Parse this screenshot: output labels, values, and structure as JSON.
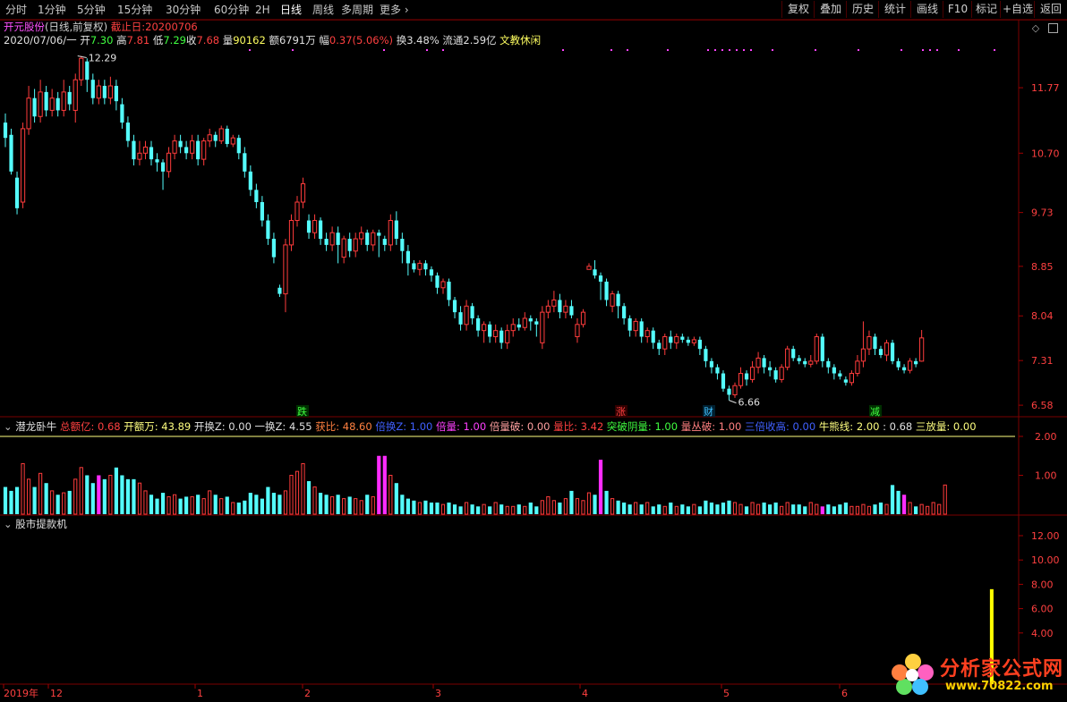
{
  "toolbar": {
    "periods": [
      "分时",
      "1分钟",
      "5分钟",
      "15分钟",
      "30分钟",
      "60分钟",
      "2H",
      "日线",
      "周线",
      "多周期",
      "更多"
    ],
    "active_index": 7,
    "right_buttons": [
      "复权",
      "叠加",
      "历史",
      "统计",
      "画线",
      "F10",
      "标记",
      "+自选",
      "返回"
    ]
  },
  "header": {
    "stock_name": "开元股份",
    "mode": "(日线,前复权)",
    "cutoff_label": "截止日:",
    "cutoff_date": "20200706",
    "date": "2020/07/06/一",
    "open_label": "开",
    "open": "7.30",
    "high_label": "高",
    "high": "7.81",
    "low_label": "低",
    "low": "7.29",
    "close_label": "收",
    "close": "7.68",
    "volume_label": "量",
    "volume": "90162",
    "amount_label": "额",
    "amount": "6791万",
    "change_label": "幅",
    "change": "0.37(5.06%)",
    "turnover_label": "换",
    "turnover": "3.48%",
    "float_label": "流通",
    "float": "2.59亿",
    "sector": "文教休闲"
  },
  "indicator1": {
    "name": "潜龙卧牛",
    "params": [
      {
        "k": "总额亿:",
        "v": "0.68",
        "color": "#ff4040"
      },
      {
        "k": "开额万:",
        "v": "43.89",
        "color": "#ffff80"
      },
      {
        "k": "开换Z:",
        "v": "0.00",
        "color": "#e0e0e0"
      },
      {
        "k": "一换Z:",
        "v": "4.55",
        "color": "#e0e0e0"
      },
      {
        "k": "获比:",
        "v": "48.60",
        "color": "#ff8040"
      },
      {
        "k": "倍换Z:",
        "v": "1.00",
        "color": "#4060ff"
      },
      {
        "k": "倍量:",
        "v": "1.00",
        "color": "#ff40ff"
      },
      {
        "k": "倍量破:",
        "v": "0.00",
        "color": "#ffa0a0"
      },
      {
        "k": "量比:",
        "v": "3.42",
        "color": "#ff4040"
      },
      {
        "k": "突破阴量:",
        "v": "1.00",
        "color": "#40ff40"
      },
      {
        "k": "量丛破:",
        "v": "1.00",
        "color": "#ff8080"
      },
      {
        "k": "三倍收高:",
        "v": "0.00",
        "color": "#4060ff"
      },
      {
        "k": "牛熊线:",
        "v": "2.00",
        "color": "#ffff80"
      },
      {
        "k": ":",
        "v": "0.68",
        "color": "#e0e0e0"
      },
      {
        "k": "三放量:",
        "v": "0.00",
        "color": "#ffff80"
      }
    ]
  },
  "indicator2": {
    "name": "股市提款机"
  },
  "axes": {
    "price_ticks": [
      "11.77",
      "10.70",
      "9.73",
      "8.85",
      "8.04",
      "7.31",
      "6.58"
    ],
    "vol_ticks": [
      "2.00",
      "1.00"
    ],
    "ind2_ticks": [
      "12.00",
      "10.00",
      "8.00",
      "6.00",
      "4.00"
    ],
    "x_labels": [
      "2019年",
      "12",
      "1",
      "2",
      "3",
      "4",
      "5",
      "6"
    ]
  },
  "annotations": {
    "high_mark": "12.29",
    "low_mark": "6.66",
    "markers": [
      "跌",
      "涨",
      "财",
      "减"
    ]
  },
  "watermark": {
    "title": "分析家公式网",
    "url": "www.70822.com"
  },
  "colors": {
    "up": "#ff3c3c",
    "down": "#54fcfc",
    "magenta": "#ff2cff",
    "yellow": "#ffff00",
    "grid": "#7a0000"
  },
  "chart_data": {
    "type": "candlestick",
    "title": "开元股份 (日线,前复权)",
    "xlabel": "",
    "ylabel": "",
    "ylim": [
      6.45,
      12.4
    ],
    "x_ticks": [
      "2019年",
      "12",
      "1",
      "2",
      "3",
      "4",
      "5",
      "6"
    ],
    "candles": [
      [
        11.2,
        10.95,
        11.35,
        10.8
      ],
      [
        11.0,
        10.4,
        11.1,
        10.35
      ],
      [
        10.3,
        9.8,
        10.4,
        9.7
      ],
      [
        9.9,
        11.1,
        11.2,
        9.8
      ],
      [
        11.1,
        11.6,
        11.8,
        11.0
      ],
      [
        11.6,
        11.3,
        11.75,
        11.2
      ],
      [
        11.3,
        11.7,
        11.9,
        11.2
      ],
      [
        11.7,
        11.4,
        11.8,
        11.3
      ],
      [
        11.4,
        11.6,
        11.75,
        11.3
      ],
      [
        11.6,
        11.4,
        11.7,
        11.3
      ],
      [
        11.4,
        11.7,
        11.9,
        11.3
      ],
      [
        11.7,
        11.5,
        11.8,
        11.4
      ],
      [
        11.4,
        11.9,
        12.0,
        11.2
      ],
      [
        11.9,
        12.25,
        12.29,
        11.8
      ],
      [
        12.2,
        11.9,
        12.25,
        11.7
      ],
      [
        11.9,
        11.6,
        12.0,
        11.5
      ],
      [
        11.6,
        11.8,
        11.9,
        11.5
      ],
      [
        11.8,
        11.6,
        11.9,
        11.5
      ],
      [
        11.6,
        11.8,
        11.95,
        11.5
      ],
      [
        11.8,
        11.55,
        11.9,
        11.4
      ],
      [
        11.5,
        11.2,
        11.6,
        11.1
      ],
      [
        11.2,
        10.9,
        11.3,
        10.8
      ],
      [
        10.9,
        10.6,
        11.0,
        10.5
      ],
      [
        10.6,
        10.7,
        10.9,
        10.5
      ],
      [
        10.7,
        10.8,
        10.9,
        10.6
      ],
      [
        10.8,
        10.6,
        10.9,
        10.5
      ],
      [
        10.6,
        10.55,
        10.7,
        10.4
      ],
      [
        10.55,
        10.4,
        10.6,
        10.1
      ],
      [
        10.4,
        10.7,
        10.8,
        10.3
      ],
      [
        10.7,
        10.9,
        11.0,
        10.6
      ],
      [
        10.9,
        10.8,
        11.0,
        10.7
      ],
      [
        10.8,
        10.7,
        10.9,
        10.6
      ],
      [
        10.7,
        10.9,
        11.0,
        10.6
      ],
      [
        10.9,
        10.6,
        11.0,
        10.5
      ],
      [
        10.6,
        10.9,
        10.95,
        10.5
      ],
      [
        10.9,
        11.0,
        11.1,
        10.8
      ],
      [
        11.0,
        10.9,
        11.05,
        10.8
      ],
      [
        10.9,
        11.1,
        11.15,
        10.85
      ],
      [
        11.1,
        10.85,
        11.15,
        10.8
      ],
      [
        10.85,
        10.95,
        11.0,
        10.8
      ],
      [
        10.95,
        10.7,
        11.0,
        10.6
      ],
      [
        10.7,
        10.4,
        10.8,
        10.3
      ],
      [
        10.4,
        10.1,
        10.5,
        10.0
      ],
      [
        10.1,
        9.9,
        10.2,
        9.8
      ],
      [
        9.9,
        9.6,
        10.0,
        9.5
      ],
      [
        9.6,
        9.3,
        9.7,
        9.2
      ],
      [
        9.3,
        9.0,
        9.4,
        8.9
      ],
      [
        8.5,
        8.4,
        8.55,
        8.35
      ],
      [
        8.4,
        9.2,
        9.3,
        8.1
      ],
      [
        9.2,
        9.6,
        9.7,
        9.1
      ],
      [
        9.6,
        9.9,
        10.0,
        9.5
      ],
      [
        9.9,
        10.2,
        10.3,
        9.8
      ],
      [
        9.6,
        9.4,
        9.7,
        9.3
      ],
      [
        9.4,
        9.6,
        9.7,
        9.3
      ],
      [
        9.6,
        9.3,
        9.65,
        9.2
      ],
      [
        9.3,
        9.2,
        9.4,
        9.1
      ],
      [
        9.2,
        9.4,
        9.5,
        9.1
      ],
      [
        9.4,
        9.2,
        9.5,
        8.9
      ],
      [
        9.0,
        9.3,
        9.35,
        8.9
      ],
      [
        9.3,
        9.1,
        9.4,
        9.0
      ],
      [
        9.1,
        9.3,
        9.4,
        9.0
      ],
      [
        9.3,
        9.4,
        9.5,
        9.2
      ],
      [
        9.4,
        9.2,
        9.45,
        9.1
      ],
      [
        9.2,
        9.4,
        9.45,
        9.1
      ],
      [
        9.4,
        9.35,
        9.45,
        9.0
      ],
      [
        9.3,
        9.2,
        9.35,
        9.1
      ],
      [
        9.2,
        9.6,
        9.7,
        9.1
      ],
      [
        9.6,
        9.3,
        9.75,
        9.2
      ],
      [
        9.3,
        9.1,
        9.4,
        8.9
      ],
      [
        9.1,
        8.9,
        9.2,
        8.7
      ],
      [
        8.9,
        8.8,
        8.95,
        8.75
      ],
      [
        8.8,
        8.9,
        8.95,
        8.7
      ],
      [
        8.9,
        8.8,
        8.95,
        8.7
      ],
      [
        8.8,
        8.7,
        8.85,
        8.6
      ],
      [
        8.7,
        8.5,
        8.75,
        8.4
      ],
      [
        8.5,
        8.6,
        8.65,
        8.4
      ],
      [
        8.6,
        8.3,
        8.65,
        8.2
      ],
      [
        8.3,
        8.1,
        8.35,
        8.0
      ],
      [
        8.1,
        7.9,
        8.2,
        7.8
      ],
      [
        7.9,
        8.2,
        8.3,
        7.8
      ],
      [
        8.2,
        8.0,
        8.25,
        7.9
      ],
      [
        8.0,
        7.8,
        8.05,
        7.7
      ],
      [
        7.8,
        7.9,
        7.95,
        7.6
      ],
      [
        7.9,
        7.7,
        7.95,
        7.6
      ],
      [
        7.7,
        7.8,
        7.9,
        7.6
      ],
      [
        7.8,
        7.6,
        7.85,
        7.5
      ],
      [
        7.6,
        7.8,
        7.9,
        7.5
      ],
      [
        7.8,
        7.9,
        8.0,
        7.7
      ],
      [
        7.9,
        7.85,
        8.0,
        7.8
      ],
      [
        7.85,
        8.0,
        8.1,
        7.8
      ],
      [
        8.0,
        7.95,
        8.05,
        7.8
      ],
      [
        7.95,
        7.9,
        8.0,
        7.7
      ],
      [
        7.6,
        8.1,
        8.2,
        7.5
      ],
      [
        8.1,
        8.2,
        8.3,
        8.0
      ],
      [
        8.2,
        8.3,
        8.45,
        8.1
      ],
      [
        8.3,
        8.1,
        8.4,
        8.0
      ],
      [
        8.1,
        8.2,
        8.3,
        8.0
      ],
      [
        8.2,
        8.05,
        8.3,
        8.0
      ],
      [
        7.7,
        7.9,
        8.0,
        7.6
      ],
      [
        7.9,
        8.1,
        8.15,
        7.85
      ],
      [
        8.8,
        8.85,
        8.9,
        8.8
      ],
      [
        8.8,
        8.7,
        8.95,
        8.65
      ],
      [
        8.7,
        8.6,
        8.75,
        8.3
      ],
      [
        8.6,
        8.3,
        8.65,
        8.2
      ],
      [
        8.2,
        8.4,
        8.45,
        8.1
      ],
      [
        8.4,
        8.2,
        8.45,
        8.0
      ],
      [
        8.2,
        8.0,
        8.25,
        7.9
      ],
      [
        8.0,
        7.8,
        8.05,
        7.7
      ],
      [
        7.8,
        7.95,
        8.0,
        7.7
      ],
      [
        7.95,
        7.7,
        8.0,
        7.6
      ],
      [
        7.7,
        7.8,
        7.85,
        7.6
      ],
      [
        7.8,
        7.6,
        7.85,
        7.5
      ],
      [
        7.6,
        7.5,
        7.65,
        7.4
      ],
      [
        7.5,
        7.7,
        7.75,
        7.4
      ],
      [
        7.7,
        7.6,
        7.8,
        7.5
      ],
      [
        7.6,
        7.7,
        7.75,
        7.5
      ],
      [
        7.7,
        7.65,
        7.75,
        7.6
      ],
      [
        7.65,
        7.6,
        7.7,
        7.55
      ],
      [
        7.6,
        7.65,
        7.7,
        7.55
      ],
      [
        7.65,
        7.5,
        7.7,
        7.4
      ],
      [
        7.5,
        7.3,
        7.55,
        7.2
      ],
      [
        7.3,
        7.2,
        7.35,
        7.1
      ],
      [
        7.2,
        7.1,
        7.25,
        7.0
      ],
      [
        7.1,
        6.85,
        7.15,
        6.8
      ],
      [
        6.85,
        6.75,
        6.9,
        6.66
      ],
      [
        6.75,
        6.9,
        6.95,
        6.7
      ],
      [
        6.9,
        7.1,
        7.2,
        6.85
      ],
      [
        7.1,
        7.0,
        7.15,
        6.9
      ],
      [
        7.0,
        7.2,
        7.3,
        6.95
      ],
      [
        7.2,
        7.35,
        7.45,
        7.1
      ],
      [
        7.35,
        7.2,
        7.4,
        7.1
      ],
      [
        7.2,
        7.15,
        7.3,
        7.05
      ],
      [
        7.15,
        7.0,
        7.2,
        6.95
      ],
      [
        7.0,
        7.2,
        7.25,
        6.95
      ],
      [
        7.2,
        7.5,
        7.55,
        7.15
      ],
      [
        7.5,
        7.35,
        7.55,
        7.3
      ],
      [
        7.35,
        7.3,
        7.4,
        7.25
      ],
      [
        7.3,
        7.25,
        7.35,
        7.2
      ],
      [
        7.25,
        7.3,
        7.4,
        7.2
      ],
      [
        7.3,
        7.7,
        7.75,
        7.25
      ],
      [
        7.7,
        7.3,
        7.75,
        7.2
      ],
      [
        7.3,
        7.2,
        7.35,
        7.1
      ],
      [
        7.2,
        7.1,
        7.25,
        7.0
      ],
      [
        7.1,
        7.05,
        7.15,
        7.0
      ],
      [
        7.0,
        6.95,
        7.05,
        6.9
      ],
      [
        6.95,
        7.1,
        7.15,
        6.9
      ],
      [
        7.1,
        7.3,
        7.4,
        7.05
      ],
      [
        7.3,
        7.5,
        7.95,
        7.2
      ],
      [
        7.5,
        7.7,
        7.8,
        7.4
      ],
      [
        7.7,
        7.5,
        7.75,
        7.4
      ],
      [
        7.5,
        7.4,
        7.55,
        7.35
      ],
      [
        7.4,
        7.6,
        7.65,
        7.3
      ],
      [
        7.6,
        7.3,
        7.65,
        7.25
      ],
      [
        7.3,
        7.2,
        7.35,
        7.15
      ],
      [
        7.2,
        7.15,
        7.25,
        7.1
      ],
      [
        7.15,
        7.3,
        7.35,
        7.1
      ],
      [
        7.3,
        7.25,
        7.35,
        7.2
      ],
      [
        7.3,
        7.68,
        7.81,
        7.29
      ]
    ],
    "volume": [
      0.7,
      0.6,
      0.7,
      1.3,
      0.9,
      0.7,
      1.05,
      0.8,
      0.6,
      0.5,
      0.55,
      0.6,
      0.9,
      1.2,
      1.0,
      0.8,
      1.0,
      0.9,
      1.0,
      1.2,
      1.0,
      0.9,
      0.9,
      0.8,
      0.6,
      0.5,
      0.4,
      0.55,
      0.45,
      0.5,
      0.4,
      0.45,
      0.45,
      0.5,
      0.4,
      0.6,
      0.5,
      0.4,
      0.45,
      0.3,
      0.3,
      0.35,
      0.55,
      0.5,
      0.4,
      0.7,
      0.55,
      0.5,
      0.6,
      1.0,
      1.1,
      1.3,
      0.85,
      0.7,
      0.55,
      0.5,
      0.45,
      0.5,
      0.4,
      0.45,
      0.4,
      0.35,
      0.5,
      0.45,
      1.5,
      1.5,
      1.0,
      0.8,
      0.5,
      0.4,
      0.35,
      0.3,
      0.35,
      0.3,
      0.3,
      0.25,
      0.3,
      0.25,
      0.2,
      0.3,
      0.25,
      0.2,
      0.25,
      0.2,
      0.3,
      0.25,
      0.2,
      0.2,
      0.25,
      0.2,
      0.3,
      0.2,
      0.35,
      0.45,
      0.35,
      0.3,
      0.4,
      0.6,
      0.4,
      0.35,
      0.55,
      0.5,
      1.4,
      0.6,
      0.4,
      0.35,
      0.3,
      0.25,
      0.3,
      0.25,
      0.3,
      0.2,
      0.25,
      0.2,
      0.3,
      0.2,
      0.25,
      0.2,
      0.25,
      0.2,
      0.35,
      0.3,
      0.25,
      0.3,
      0.35,
      0.3,
      0.25,
      0.2,
      0.3,
      0.25,
      0.3,
      0.25,
      0.3,
      0.2,
      0.3,
      0.25,
      0.25,
      0.2,
      0.3,
      0.25,
      0.2,
      0.25,
      0.2,
      0.25,
      0.3,
      0.2,
      0.2,
      0.25,
      0.2,
      0.25,
      0.3,
      0.25,
      0.75,
      0.6,
      0.5,
      0.3,
      0.2,
      0.25,
      0.2,
      0.3,
      0.25,
      0.75
    ],
    "volume_magenta": [
      16,
      64,
      65,
      102,
      140,
      154,
      164,
      169
    ],
    "ind2_bar": {
      "index": 169,
      "value": 7.6
    }
  }
}
